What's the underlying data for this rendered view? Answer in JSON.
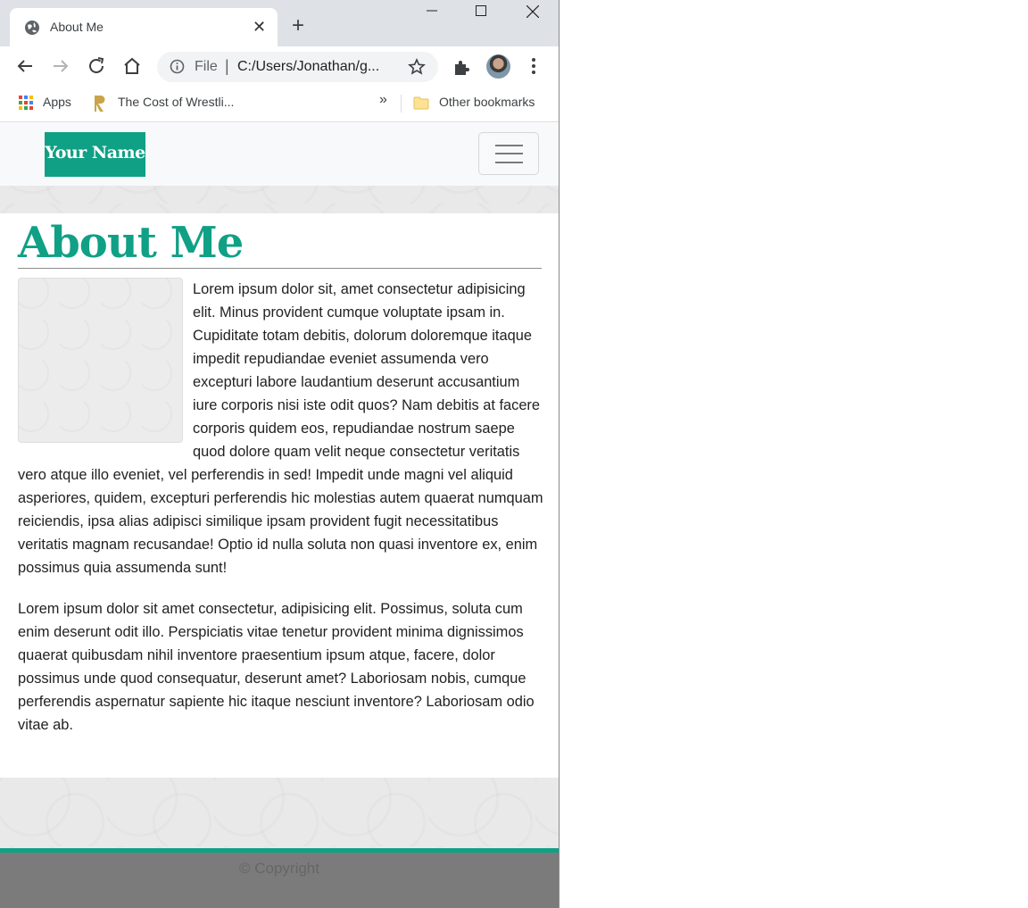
{
  "browser": {
    "tab_title": "About Me",
    "tab_close": "✕",
    "new_tab": "+",
    "omnibox": {
      "scheme": "File",
      "separator": "|",
      "url": "C:/Users/Jonathan/g..."
    },
    "bookmarks": {
      "apps": "Apps",
      "item1": "The Cost of Wrestli...",
      "overflow": "»",
      "other": "Other bookmarks"
    }
  },
  "site": {
    "brand": "Your Name",
    "heading": "About Me",
    "paragraphs": [
      "Lorem ipsum dolor sit, amet consectetur adipisicing elit. Minus provident cumque voluptate ipsam in. Cupiditate totam debitis, dolorum doloremque itaque impedit repudiandae eveniet assumenda vero excepturi labore laudantium deserunt accusantium iure corporis nisi iste odit quos? Nam debitis at facere corporis quidem eos, repudiandae nostrum saepe quod dolore quam velit neque consectetur veritatis vero atque illo eveniet, vel perferendis in sed! Impedit unde magni vel aliquid asperiores, quidem, excepturi perferendis hic molestias autem quaerat numquam reiciendis, ipsa alias adipisci similique ipsam provident fugit necessitatibus veritatis magnam recusandae! Optio id nulla soluta non quasi inventore ex, enim possimus quia assumenda sunt!",
      "Lorem ipsum dolor sit amet consectetur, adipisicing elit. Possimus, soluta cum enim deserunt odit illo. Perspiciatis vitae tenetur provident minima dignissimos quaerat quibusdam nihil inventore praesentium ipsum atque, facere, dolor possimus unde quod consequatur, deserunt amet? Laboriosam nobis, cumque perferendis aspernatur sapiente hic itaque nesciunt inventore? Laboriosam odio vitae ab."
    ],
    "footer": "© Copyright"
  },
  "colors": {
    "accent": "#10a085",
    "footer_bg": "#7b7b7b"
  }
}
